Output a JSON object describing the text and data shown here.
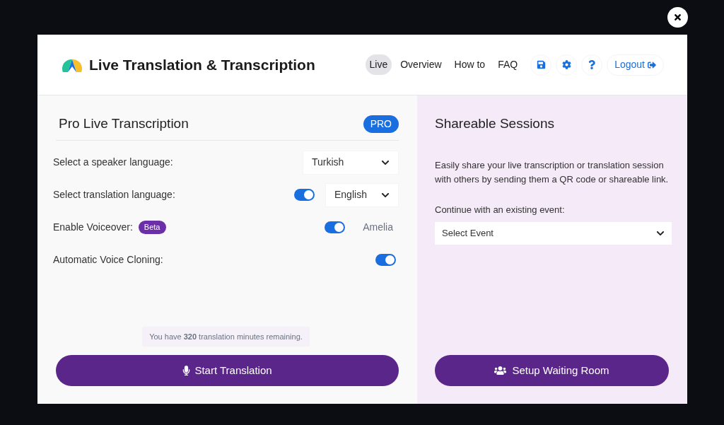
{
  "app_title": "Live Translation & Transcription",
  "nav": [
    {
      "label": "Live",
      "selected": true
    },
    {
      "label": "Overview",
      "selected": false
    },
    {
      "label": "How to",
      "selected": false
    },
    {
      "label": "FAQ",
      "selected": false
    }
  ],
  "logout": "Logout",
  "transcription": {
    "title": "Pro Live Transcription",
    "badge": "PRO",
    "rows": [
      {
        "kind": "select",
        "label": "Select a speaker language:",
        "value": "Turkish"
      },
      {
        "kind": "toggle-select",
        "label": "Select translation language:",
        "on": true,
        "value": "English"
      },
      {
        "kind": "toggle-voice",
        "label": "Enable Voiceover:",
        "tag": "Beta",
        "on": true,
        "value": "Amelia"
      },
      {
        "kind": "toggle",
        "label": "Automatic Voice Cloning:",
        "on": true
      }
    ],
    "remaining": "You have **320** translation minutes remaining.",
    "start_button": "Start Translation"
  },
  "sessions": {
    "title": "Shareable Sessions",
    "description": "Easily share your live transcription or translation session with others by sending them a QR code or shareable link.",
    "event_label": "Continue with an existing event:",
    "event_select": "Select Event",
    "setup_button": "Setup Waiting Room"
  }
}
